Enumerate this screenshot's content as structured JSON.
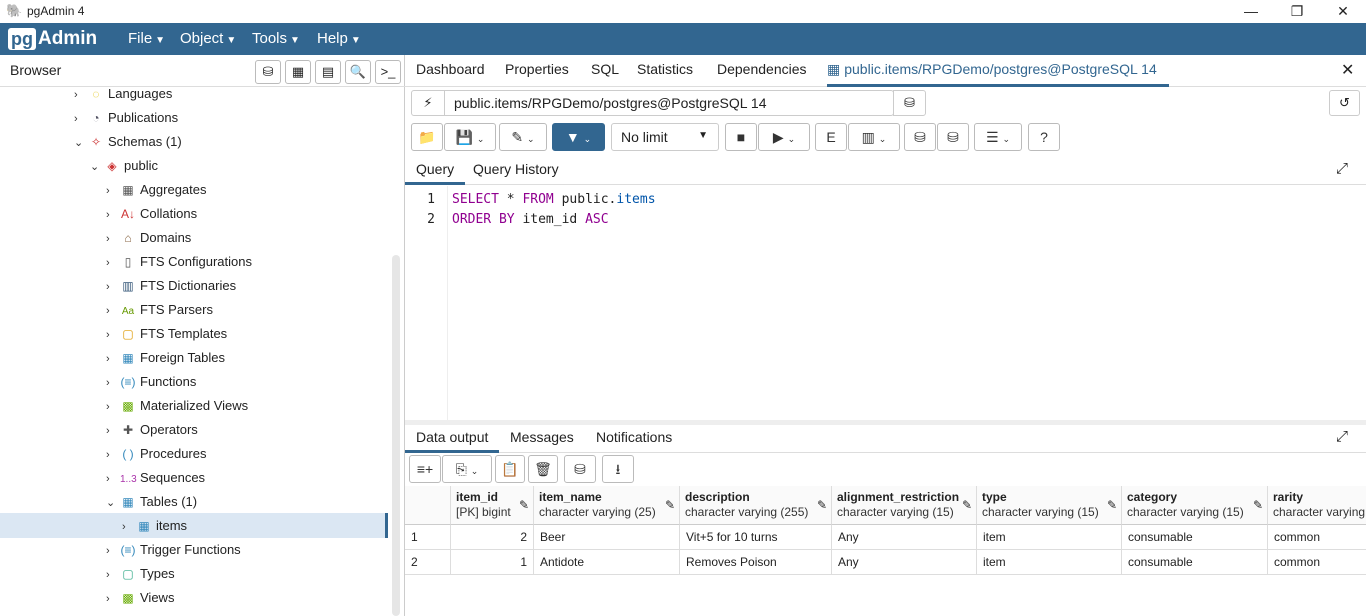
{
  "window": {
    "title": "pgAdmin 4",
    "controls": [
      "—",
      "❐",
      "✕"
    ]
  },
  "menubar": {
    "logo_pg": "pg",
    "logo_admin": "Admin",
    "items": [
      "File",
      "Object",
      "Tools",
      "Help"
    ]
  },
  "browser": {
    "title": "Browser",
    "tree": [
      {
        "label": "Languages",
        "icon": "languages-icon"
      },
      {
        "label": "Publications",
        "icon": "publications-icon"
      },
      {
        "label": "Schemas (1)",
        "icon": "schemas-icon"
      },
      {
        "label": "public",
        "icon": "schema-icon"
      },
      {
        "label": "Aggregates",
        "icon": "aggregates-icon"
      },
      {
        "label": "Collations",
        "icon": "collations-icon"
      },
      {
        "label": "Domains",
        "icon": "domains-icon"
      },
      {
        "label": "FTS Configurations",
        "icon": "fts-configurations-icon"
      },
      {
        "label": "FTS Dictionaries",
        "icon": "fts-dictionaries-icon"
      },
      {
        "label": "FTS Parsers",
        "icon": "fts-parsers-icon"
      },
      {
        "label": "FTS Templates",
        "icon": "fts-templates-icon"
      },
      {
        "label": "Foreign Tables",
        "icon": "foreign-tables-icon"
      },
      {
        "label": "Functions",
        "icon": "functions-icon"
      },
      {
        "label": "Materialized Views",
        "icon": "materialized-views-icon"
      },
      {
        "label": "Operators",
        "icon": "operators-icon"
      },
      {
        "label": "Procedures",
        "icon": "procedures-icon"
      },
      {
        "label": "Sequences",
        "icon": "sequences-icon"
      },
      {
        "label": "Tables (1)",
        "icon": "tables-icon"
      },
      {
        "label": "items",
        "icon": "table-icon"
      },
      {
        "label": "Trigger Functions",
        "icon": "trigger-functions-icon"
      },
      {
        "label": "Types",
        "icon": "types-icon"
      },
      {
        "label": "Views",
        "icon": "views-icon"
      }
    ]
  },
  "tabs": {
    "items": [
      "Dashboard",
      "Properties",
      "SQL",
      "Statistics",
      "Dependencies"
    ],
    "active": "public.items/RPGDemo/postgres@PostgreSQL 14"
  },
  "connection": {
    "label": "public.items/RPGDemo/postgres@PostgreSQL 14"
  },
  "toolbar": {
    "limit": "No limit"
  },
  "query_tabs": {
    "active": "Query",
    "other": "Query History"
  },
  "editor": {
    "lines": [
      {
        "n": "1",
        "kw1": "SELECT",
        "rest1": " * ",
        "kw2": "FROM",
        "schema": " public.",
        "table": "items"
      },
      {
        "n": "2",
        "kw1": "ORDER BY",
        "rest1": " item_id ",
        "kw2": "ASC"
      }
    ]
  },
  "output_tabs": {
    "active": "Data output",
    "items": [
      "Messages",
      "Notifications"
    ]
  },
  "grid": {
    "columns": [
      {
        "name": "item_id",
        "type": "[PK] bigint"
      },
      {
        "name": "item_name",
        "type": "character varying (25)"
      },
      {
        "name": "description",
        "type": "character varying (255)"
      },
      {
        "name": "alignment_restriction",
        "type": "character varying (15)"
      },
      {
        "name": "type",
        "type": "character varying (15)"
      },
      {
        "name": "category",
        "type": "character varying (15)"
      },
      {
        "name": "rarity",
        "type": "character varying"
      }
    ],
    "rows": [
      {
        "rn": "1",
        "cells": [
          "2",
          "Beer",
          "Vit+5 for 10 turns",
          "Any",
          "item",
          "consumable",
          "common"
        ]
      },
      {
        "rn": "2",
        "cells": [
          "1",
          "Antidote",
          "Removes Poison",
          "Any",
          "item",
          "consumable",
          "common"
        ]
      }
    ]
  }
}
